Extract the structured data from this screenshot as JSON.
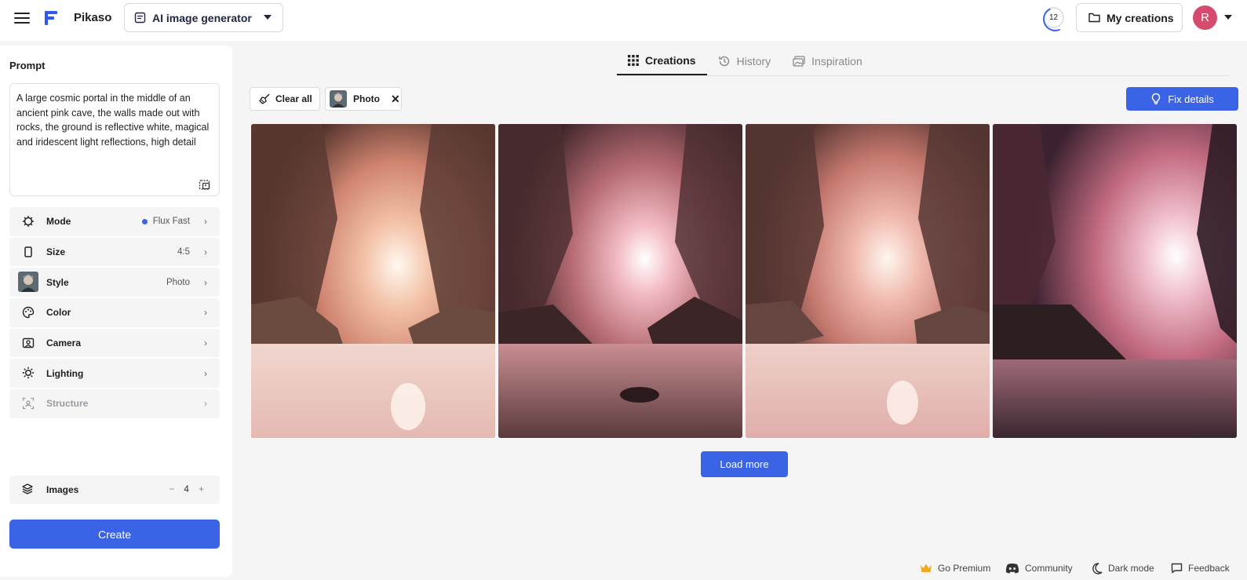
{
  "header": {
    "app_name": "Pikaso",
    "tool": "AI image generator",
    "credits": "12",
    "my_creations": "My creations",
    "avatar_initial": "R"
  },
  "sidebar": {
    "prompt_title": "Prompt",
    "prompt_text": "A large cosmic portal in the middle of an ancient pink cave, the walls made out with rocks, the ground is reflective white, magical and iridescent light reflections, high detail",
    "options": [
      {
        "name": "Mode",
        "value": "Flux Fast",
        "icon": "mode-icon"
      },
      {
        "name": "Size",
        "value": "4:5",
        "icon": "size-icon"
      },
      {
        "name": "Style",
        "value": "Photo",
        "icon": "style-thumbnail"
      },
      {
        "name": "Color",
        "value": "",
        "icon": "palette-icon"
      },
      {
        "name": "Camera",
        "value": "",
        "icon": "camera-icon"
      },
      {
        "name": "Lighting",
        "value": "",
        "icon": "sun-icon"
      },
      {
        "name": "Structure",
        "value": "",
        "icon": "structure-icon"
      }
    ],
    "images_label": "Images",
    "images_count": "4",
    "create_label": "Create"
  },
  "main": {
    "tabs": [
      {
        "label": "Creations",
        "icon": "grid-icon"
      },
      {
        "label": "History",
        "icon": "history-icon"
      },
      {
        "label": "Inspiration",
        "icon": "inspiration-icon"
      }
    ],
    "clear_all": "Clear all",
    "filter_chip": "Photo",
    "fix_details": "Fix details",
    "load_more": "Load more"
  },
  "footer": {
    "go_premium": "Go Premium",
    "community": "Community",
    "dark_mode": "Dark mode",
    "feedback": "Feedback"
  },
  "colors": {
    "accent": "#3b63e6",
    "avatar": "#d54b6e"
  }
}
